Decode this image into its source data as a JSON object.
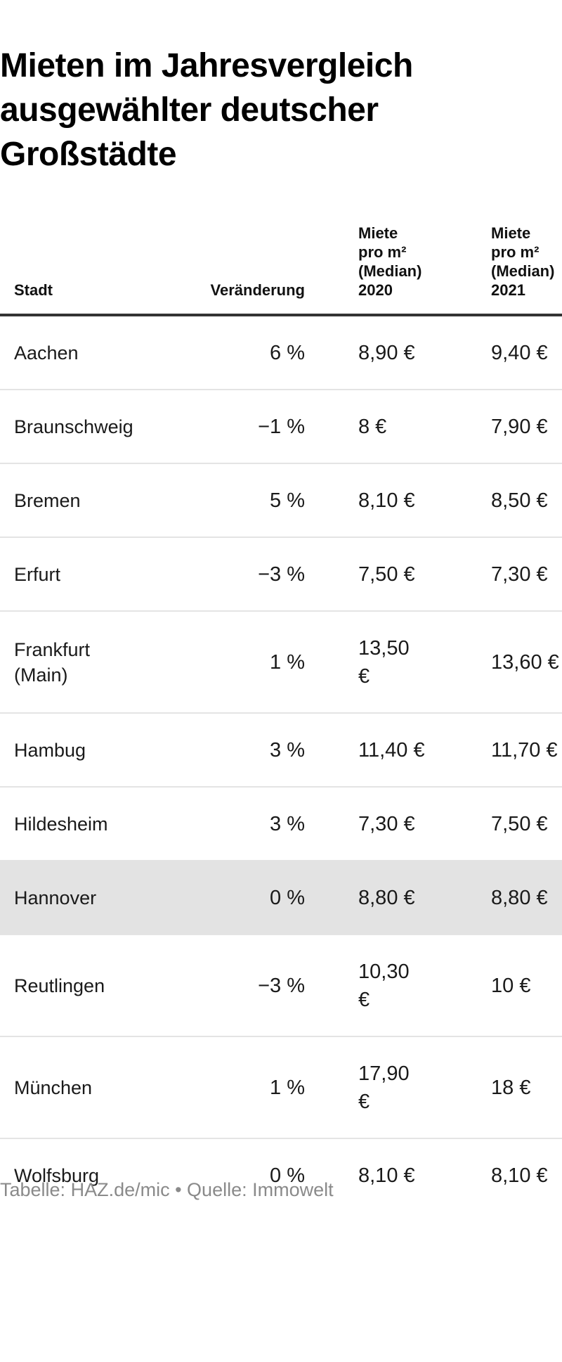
{
  "title": "Mieten im Jahresvergleich ausgewählter deutscher Großstädte",
  "columns": {
    "stadt": "Stadt",
    "change": "Veränderung",
    "rent2020": [
      "Miete",
      "pro m²",
      "(Median)",
      "2020"
    ],
    "rent2021": [
      "Miete",
      "pro m²",
      "(Median)",
      "2021"
    ]
  },
  "rows": [
    {
      "stadt": "Aachen",
      "change": "6 %",
      "rent2020": "8,90 €",
      "rent2021": "9,40 €"
    },
    {
      "stadt": "Braunschweig",
      "change": "−1 %",
      "rent2020": "8 €",
      "rent2021": "7,90 €"
    },
    {
      "stadt": "Bremen",
      "change": "5 %",
      "rent2020": "8,10 €",
      "rent2021": "8,50 €"
    },
    {
      "stadt": "Erfurt",
      "change": "−3 %",
      "rent2020": "7,50 €",
      "rent2021": "7,30 €"
    },
    {
      "stadt": "Frankfurt (Main)",
      "change": "1 %",
      "rent2020": "13,50 €",
      "rent2021": "13,60 €"
    },
    {
      "stadt": "Hambug",
      "change": "3 %",
      "rent2020": "11,40 €",
      "rent2021": "11,70 €"
    },
    {
      "stadt": "Hildesheim",
      "change": "3 %",
      "rent2020": "7,30 €",
      "rent2021": "7,50 €"
    },
    {
      "stadt": "Hannover",
      "change": "0 %",
      "rent2020": "8,80 €",
      "rent2021": "8,80 €"
    },
    {
      "stadt": "Reutlingen",
      "change": "−3 %",
      "rent2020": "10,30 €",
      "rent2021": "10 €"
    },
    {
      "stadt": "München",
      "change": "1 %",
      "rent2020": "17,90 €",
      "rent2021": "18 €"
    },
    {
      "stadt": "Wolfsburg",
      "change": "0 %",
      "rent2020": "8,10 €",
      "rent2021": "8,10 €"
    }
  ],
  "footer": "Tabelle: HAZ.de/mic • Quelle: Immowelt",
  "colors": {
    "highlight_row": "#e3e3e3",
    "header_rule": "#333333",
    "row_rule": "#e4e4e4",
    "footer_text": "#8a8a8a"
  },
  "chart_data": {
    "type": "table",
    "title": "Mieten im Jahresvergleich ausgewählter deutscher Großstädte",
    "columns": [
      "Stadt",
      "Veränderung",
      "Miete pro m² (Median) 2020",
      "Miete pro m² (Median) 2021"
    ],
    "rows": [
      [
        "Aachen",
        "6 %",
        "8,90 €",
        "9,40 €"
      ],
      [
        "Braunschweig",
        "−1 %",
        "8 €",
        "7,90 €"
      ],
      [
        "Bremen",
        "5 %",
        "8,10 €",
        "8,50 €"
      ],
      [
        "Erfurt",
        "−3 %",
        "7,50 €",
        "7,30 €"
      ],
      [
        "Frankfurt (Main)",
        "1 %",
        "13,50 €",
        "13,60 €"
      ],
      [
        "Hambug",
        "3 %",
        "11,40 €",
        "11,70 €"
      ],
      [
        "Hildesheim",
        "3 %",
        "7,30 €",
        "7,50 €"
      ],
      [
        "Hannover",
        "0 %",
        "8,80 €",
        "8,80 €"
      ],
      [
        "Reutlingen",
        "−3 %",
        "10,30 €",
        "10 €"
      ],
      [
        "München",
        "1 %",
        "17,90 €",
        "18 €"
      ],
      [
        "Wolfsburg",
        "0 %",
        "8,10 €",
        "8,10 €"
      ]
    ],
    "highlighted_row": "Hannover"
  }
}
